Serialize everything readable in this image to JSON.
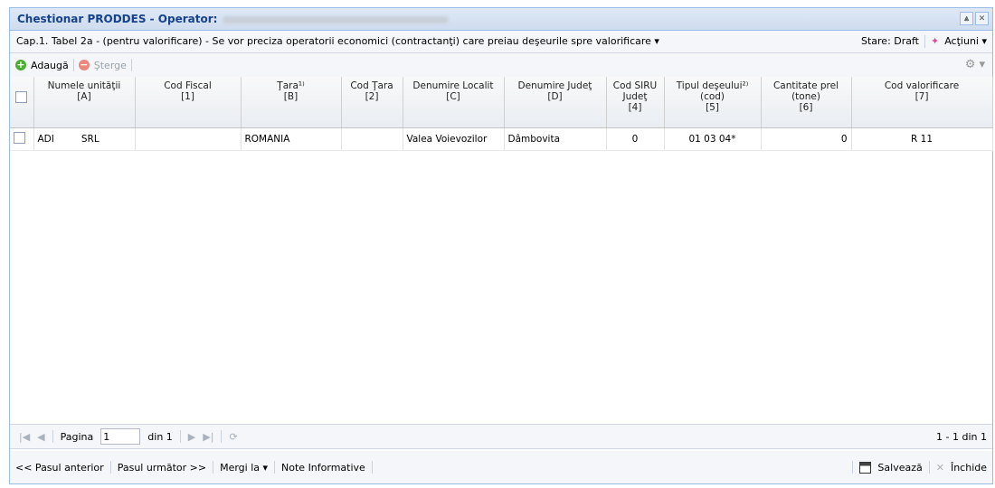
{
  "window": {
    "title": "Chestionar PRODDES - Operator:",
    "tools": [
      "⩓",
      "✕"
    ]
  },
  "caption": {
    "text": "Cap.1. Tabel 2a - (pentru valorificare) - Se vor preciza operatorii economici (contractanţi) care preiau deşeurile spre valorificare ▾",
    "status": "Stare: Draft",
    "actions": "Acţiuni ▾"
  },
  "toolbar": {
    "add": "Adaugă",
    "delete": "Şterge"
  },
  "grid": {
    "columns": [
      {
        "label": "Numele unităţii",
        "code": "[A]"
      },
      {
        "label": "Cod Fiscal",
        "code": "[1]"
      },
      {
        "label": "Ţara¹⁾",
        "code": "[B]"
      },
      {
        "label": "Cod Ţara",
        "code": "[2]"
      },
      {
        "label": "Denumire Localit",
        "code": "[C]"
      },
      {
        "label": "Denumire Judeţ",
        "code": "[D]"
      },
      {
        "label": "Cod SIRU Judeţ",
        "code": "[4]"
      },
      {
        "label": "Tipul deşeului²⁾ (cod)",
        "code": "[5]"
      },
      {
        "label": "Cantitate prel (tone)",
        "code": "[6]"
      },
      {
        "label": "Cod valorificare",
        "code": "[7]"
      }
    ],
    "rows": [
      {
        "name": "ADI",
        "name_suffix": "SRL",
        "cod_fiscal": "",
        "tara": "ROMANIA",
        "cod_tara": "",
        "localitate": "Valea Voievozilor",
        "judet": "Dâmbovita",
        "cod_siruta": "0",
        "tip_deseu": "01 03 04*",
        "cantitate": "0",
        "cod_valorificare": "R 11"
      }
    ]
  },
  "pager": {
    "page_label": "Pagina",
    "page_value": "1",
    "of_label": "din 1",
    "count": "1 - 1 din 1"
  },
  "footer": {
    "prev": "<< Pasul anterior",
    "next": "Pasul următor >>",
    "goto": "Mergi la ▾",
    "notes": "Note Informative",
    "save": "Salvează",
    "close": "Închide"
  }
}
